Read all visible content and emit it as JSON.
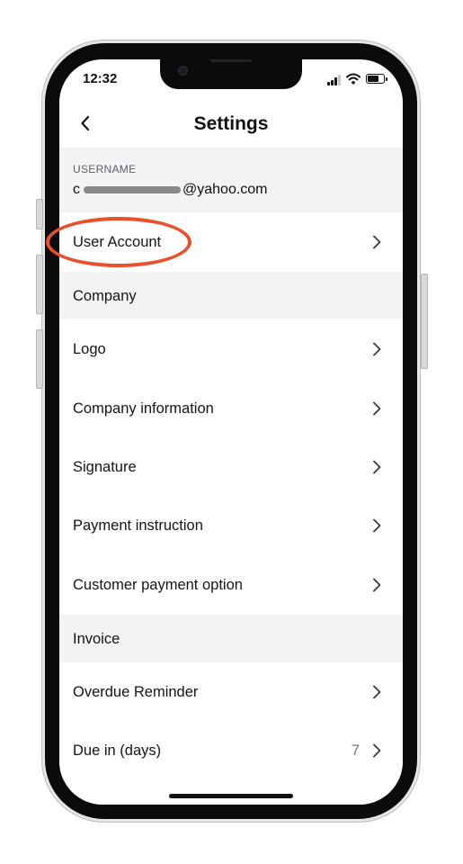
{
  "status_bar": {
    "time": "12:32"
  },
  "header": {
    "title": "Settings"
  },
  "account": {
    "label": "USERNAME",
    "email_prefix": "c",
    "email_suffix": "@yahoo.com"
  },
  "rows": {
    "user_account": "User Account",
    "logo": "Logo",
    "company_information": "Company information",
    "signature": "Signature",
    "payment_instruction": "Payment instruction",
    "customer_payment_option": "Customer payment option",
    "overdue_reminder": "Overdue Reminder",
    "due_in_days": "Due in (days)",
    "due_in_days_value": "7"
  },
  "sections": {
    "company": "Company",
    "invoice": "Invoice"
  },
  "colors": {
    "annotation": "#e8502e",
    "section_bg": "#f2f3f5"
  },
  "icons": {
    "back": "chevron-left-icon",
    "row_arrow": "chevron-right-icon"
  }
}
